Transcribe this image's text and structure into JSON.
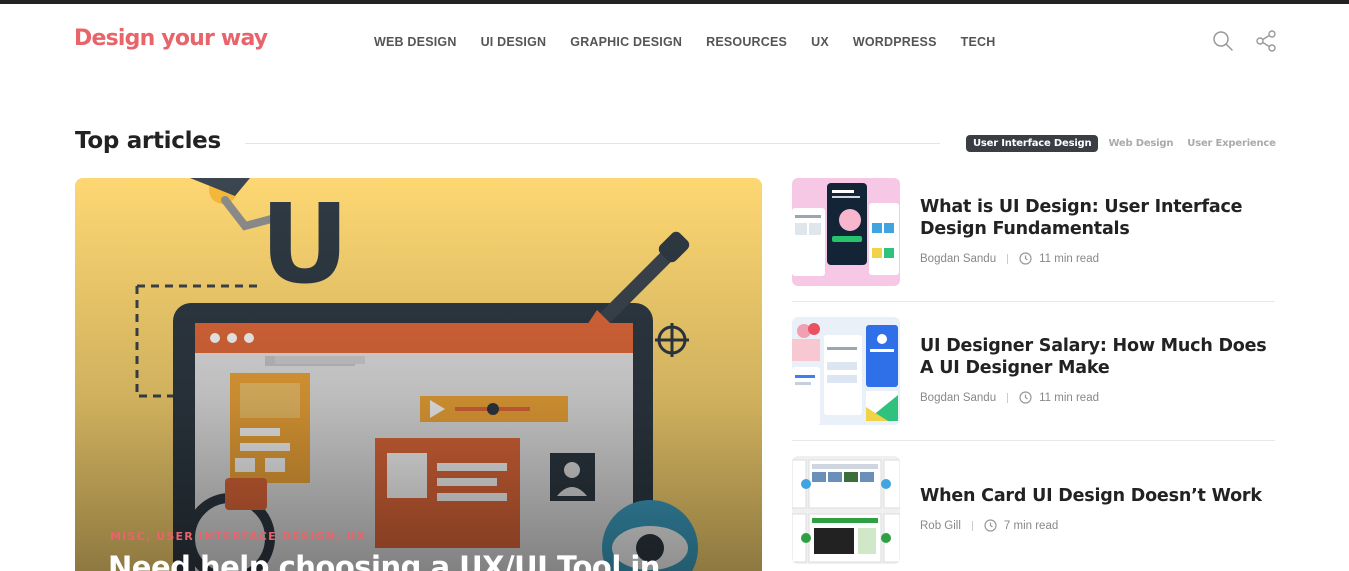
{
  "brand": {
    "logo_text": "Design your way",
    "accent_color": "#e8646a"
  },
  "nav": {
    "items": [
      {
        "label": "WEB DESIGN"
      },
      {
        "label": "UI DESIGN"
      },
      {
        "label": "GRAPHIC DESIGN"
      },
      {
        "label": "RESOURCES"
      },
      {
        "label": "UX"
      },
      {
        "label": "WORDPRESS"
      },
      {
        "label": "TECH"
      }
    ],
    "search_icon": "search-icon",
    "share_icon": "share-icon"
  },
  "section": {
    "title": "Top articles",
    "filters": [
      {
        "label": "User Interface Design",
        "active": true
      },
      {
        "label": "Web Design",
        "active": false
      },
      {
        "label": "User Experience",
        "active": false
      }
    ]
  },
  "hero": {
    "categories": "MISC, USER INTERFACE DESIGN, UX",
    "title": "Need help choosing a UX/UI Tool in",
    "illustration_text": "U"
  },
  "articles": [
    {
      "title": "What is UI Design: User Interface Design Fundamentals",
      "author": "Bogdan Sandu",
      "read_time": "11 min read"
    },
    {
      "title": "UI Designer Salary: How Much Does A UI Designer Make",
      "author": "Bogdan Sandu",
      "read_time": "11 min read"
    },
    {
      "title": "When Card UI Design Doesn’t Work",
      "author": "Rob Gill",
      "read_time": "7 min read"
    }
  ]
}
